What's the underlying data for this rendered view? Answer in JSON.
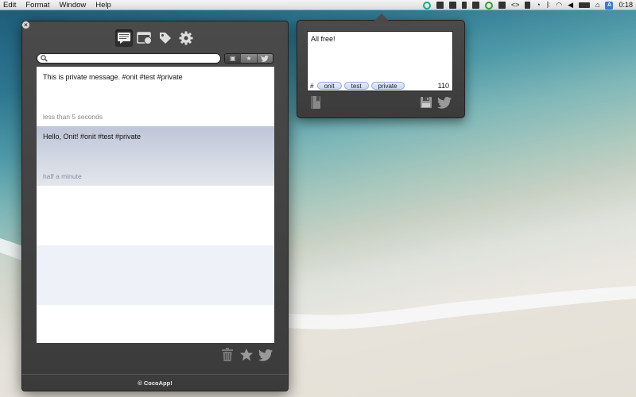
{
  "menubar": {
    "items": [
      "Edit",
      "Format",
      "Window",
      "Help"
    ],
    "clock": "0:18"
  },
  "main_window": {
    "search": {
      "value": "",
      "placeholder": ""
    },
    "messages": [
      {
        "text": "This is private message. #onit #test #private",
        "time": "less than 5 seconds",
        "selected": false
      },
      {
        "text": "Hello, Onit! #onit #test #private",
        "time": "half a minute",
        "selected": true
      }
    ],
    "footer": "© CocoApp!"
  },
  "popover": {
    "text": "All free!",
    "tags_prefix": "#",
    "tags": [
      "onit",
      "test",
      "private"
    ],
    "char_count": "110"
  },
  "colors": {
    "panel_bg": "#3f3f3f",
    "selected_row": "#c6cddc",
    "alt_row": "#eef1f7",
    "tag_bg": "#d6e1f6",
    "status_accent": "#19a689"
  },
  "icons": {
    "toolbar": [
      "messages-icon",
      "browser-globe-icon",
      "tags-icon",
      "gear-icon"
    ],
    "bottom": [
      "trash-icon",
      "star-icon",
      "twitter-bird-icon"
    ],
    "popover": [
      "bookmark-book-icon",
      "save-disk-icon",
      "twitter-bird-icon"
    ]
  }
}
